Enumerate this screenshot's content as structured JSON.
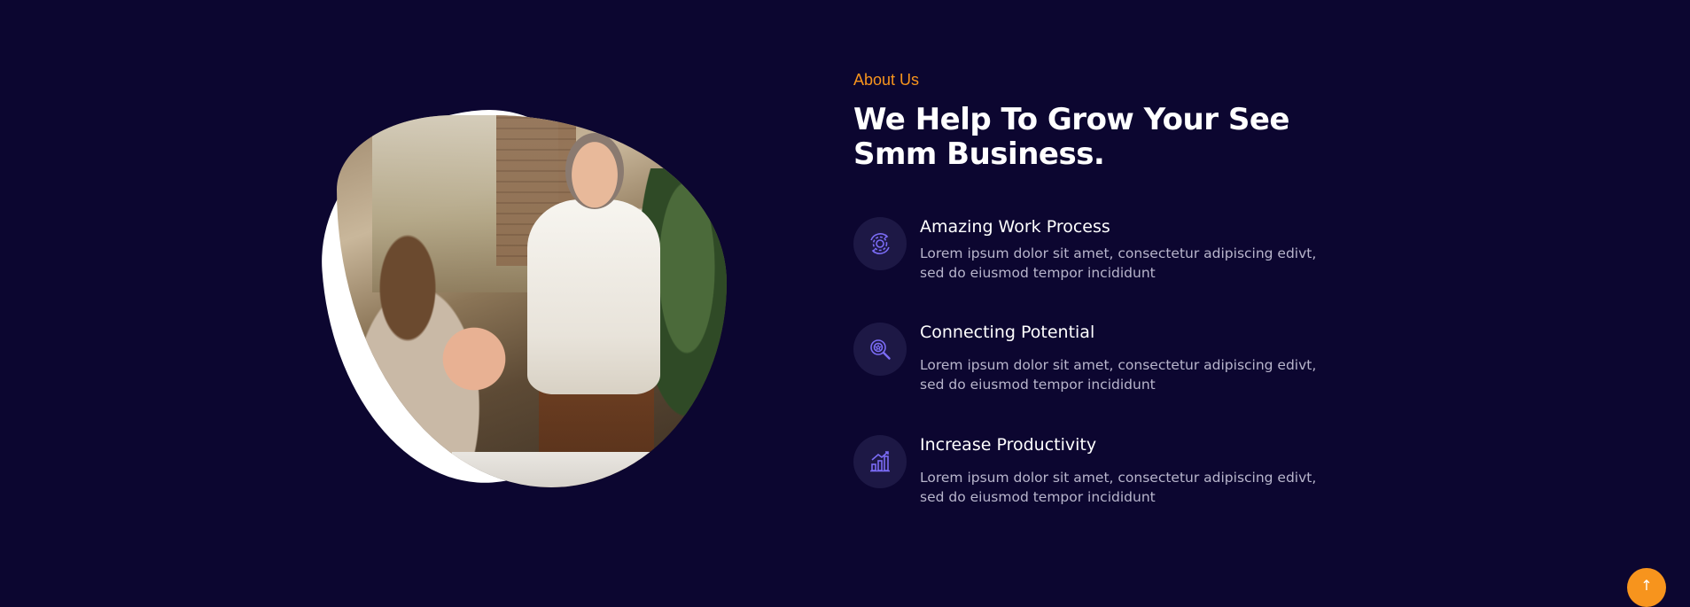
{
  "about": {
    "eyebrow": "About Us",
    "headline": "We Help To Grow Your See Smm Business.",
    "photo_icon": "team-meeting-photo"
  },
  "features": [
    {
      "icon": "gear-cycle-icon",
      "title": "Amazing Work Process",
      "description": "Lorem ipsum dolor sit amet, consectetur adipiscing edivt, sed do eiusmod tempor incididunt"
    },
    {
      "icon": "search-star-icon",
      "title": "Connecting Potential",
      "description": "Lorem ipsum dolor sit amet, consectetur adipiscing edivt, sed do eiusmod tempor incididunt"
    },
    {
      "icon": "growth-chart-icon",
      "title": "Increase Productivity",
      "description": "Lorem ipsum dolor sit amet, consectetur adipiscing edivt, sed do eiusmod tempor incididunt"
    }
  ],
  "scroll_top": {
    "icon": "arrow-up-icon",
    "glyph": "↑"
  },
  "colors": {
    "background": "#0c0630",
    "accent": "#f7941d",
    "icon_circle": "#1d1845",
    "icon_stroke": "#7b6cf6",
    "heading": "#ffffff",
    "body_text": "#b8b5cc"
  }
}
